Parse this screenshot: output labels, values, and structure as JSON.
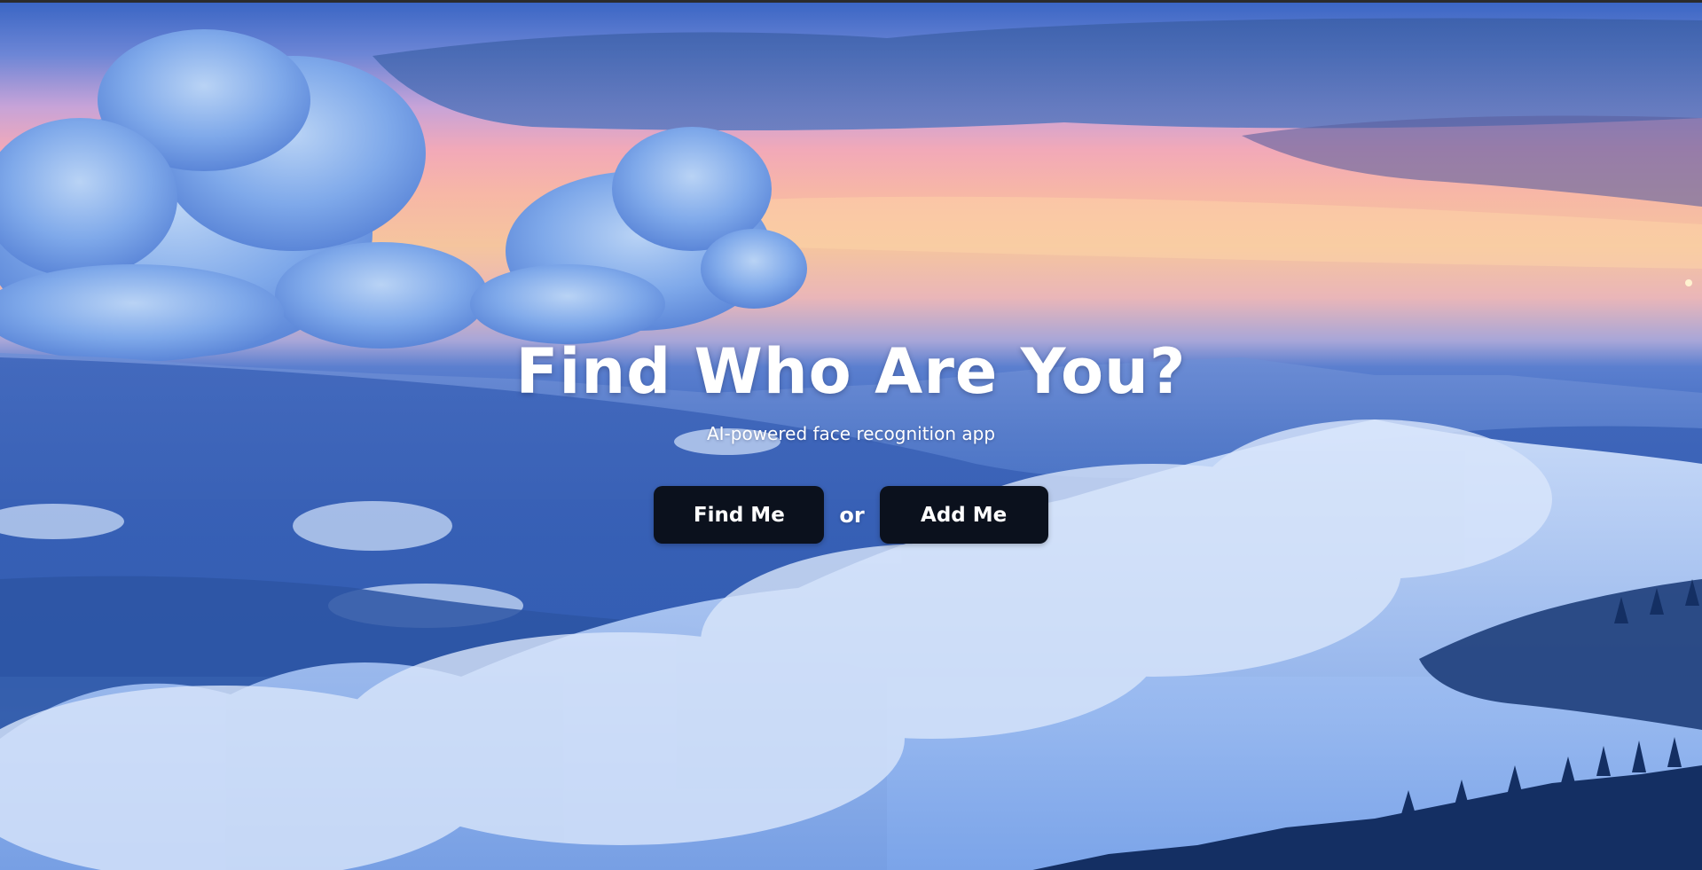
{
  "hero": {
    "title": "Find Who Are You?",
    "subtitle": "AI-powered face recognition app",
    "find_button_label": "Find Me",
    "separator": "or",
    "add_button_label": "Add Me"
  },
  "colors": {
    "button_background": "#0b111d",
    "button_text": "#ffffff",
    "heading_text": "#ffffff"
  }
}
